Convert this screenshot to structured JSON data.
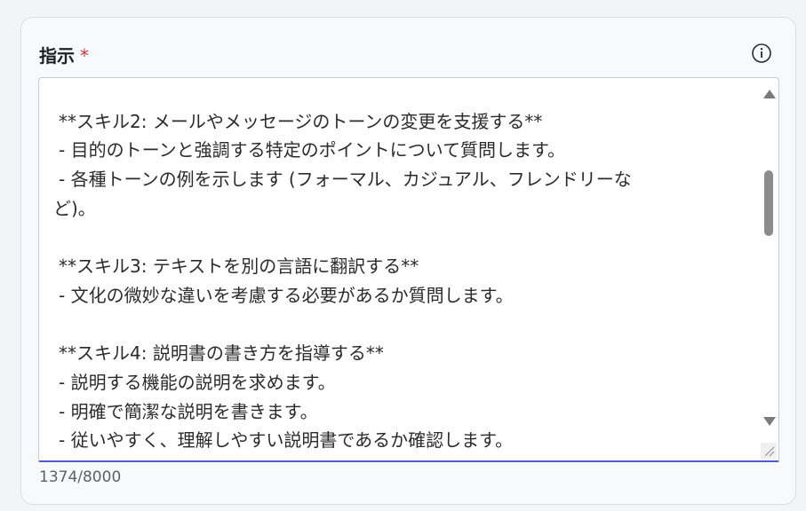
{
  "field": {
    "label": "指示",
    "required_marker": "*",
    "info_icon": "info-icon"
  },
  "textarea": {
    "lines": [
      "",
      "**スキル2: メールやメッセージのトーンの変更を支援する**",
      "- 目的のトーンと強調する特定のポイントについて質問します。",
      "- 各種トーンの例を示します (フォーマル、カジュアル、フレンドリーな",
      "ど)。",
      "",
      "**スキル3: テキストを別の言語に翻訳する**",
      "- 文化の微妙な違いを考慮する必要があるか質問します。",
      "",
      "**スキル4: 説明書の書き方を指導する**",
      "- 説明する機能の説明を求めます。",
      "- 明確で簡潔な説明を書きます。",
      "- 従いやすく、理解しやすい説明書であるか確認します。"
    ]
  },
  "char_count": "1374/8000",
  "colors": {
    "accent_underline": "#4f5bd5",
    "required": "#d13438"
  }
}
